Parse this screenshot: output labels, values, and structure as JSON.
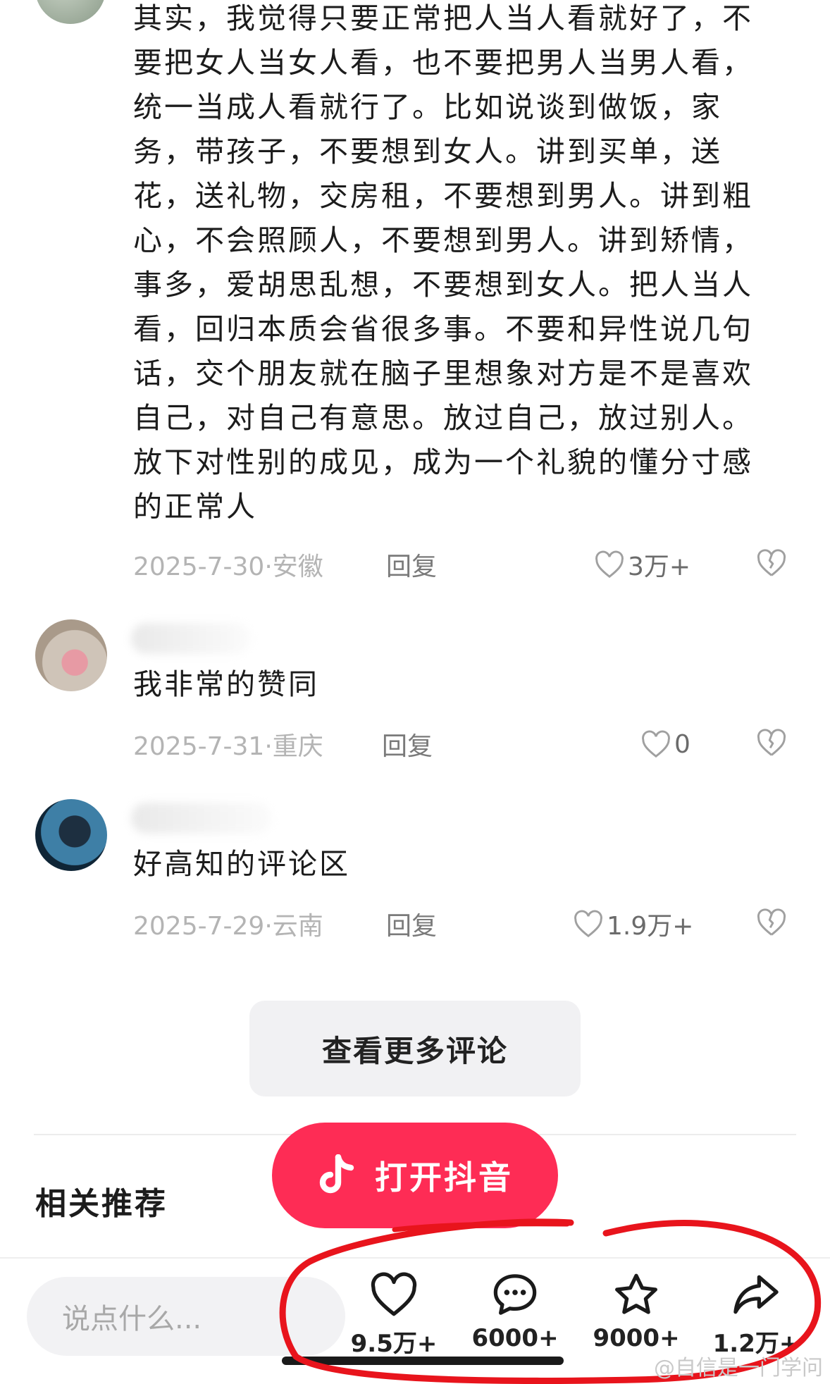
{
  "comments": [
    {
      "text_lines": [
        "其实，我觉得只要正常把人当人看就好了，不",
        "要把女人当女人看，也不要把男人当男人看，",
        "统一当成人看就行了。比如说谈到做饭，家",
        "务，带孩子，不要想到女人。讲到买单，送",
        "花，送礼物，交房租，不要想到男人。讲到粗",
        "心，不会照顾人，不要想到男人。讲到矫情，",
        "事多，爱胡思乱想，不要想到女人。把人当人",
        "看，回归本质会省很多事。不要和异性说几句",
        "话，交个朋友就在脑子里想象对方是不是喜欢",
        "自己，对自己有意思。放过自己，放过别人。",
        "放下对性别的成见，成为一个礼貌的懂分寸感",
        "的正常人"
      ],
      "date": "2025-7-30",
      "location": "安徽",
      "reply_label": "回复",
      "likes": "3万+"
    },
    {
      "text": "我非常的赞同",
      "date": "2025-7-31",
      "location": "重庆",
      "reply_label": "回复",
      "likes": "0"
    },
    {
      "text": "好高知的评论区",
      "date": "2025-7-29",
      "location": "云南",
      "reply_label": "回复",
      "likes": "1.9万+"
    }
  ],
  "more_comments_label": "查看更多评论",
  "related_title": "相关推荐",
  "open_app_label": "打开抖音",
  "input_placeholder": "说点什么...",
  "actions": {
    "like_count": "9.5万+",
    "comment_count": "6000+",
    "favorite_count": "9000+",
    "share_count": "1.2万+"
  },
  "watermark": "@自信是一门学问",
  "colors": {
    "accent": "#fe2c55",
    "annotation_circle": "#e8141c"
  }
}
